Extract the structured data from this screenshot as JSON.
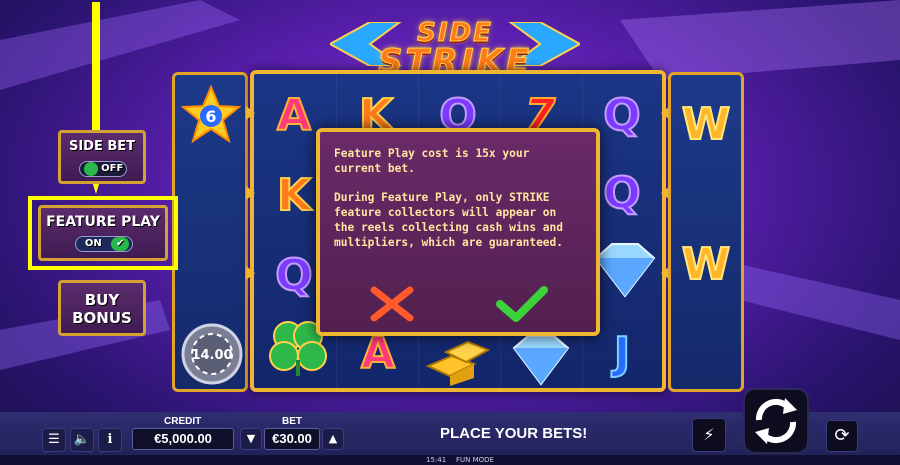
{
  "logo": {
    "line1": "SIDE",
    "line2": "STRIKE"
  },
  "side_reel_left": {
    "star_value": "6",
    "chip_value": "14.00"
  },
  "main_reels": {
    "visible_symbols": [
      "A",
      "K",
      "Q",
      "7",
      "Q",
      "K",
      "Q",
      "Q",
      "A",
      "J"
    ]
  },
  "side_reel_right": {
    "symbols": [
      "W",
      "W"
    ]
  },
  "popup": {
    "paragraph1": "Feature Play cost is 15x your current bet.",
    "paragraph2": "During Feature Play, only STRIKE feature collectors will appear on the reels collecting cash wins and multipliers, which are guaranteed.",
    "cancel_icon": "x-icon",
    "confirm_icon": "check-icon"
  },
  "left_panel": {
    "side_bet": {
      "label": "SIDE BET",
      "toggle_label": "OFF"
    },
    "feature_play": {
      "label": "FEATURE PLAY",
      "toggle_label": "ON"
    },
    "buy_bonus": {
      "line1": "BUY",
      "line2": "BONUS"
    }
  },
  "bottom_bar": {
    "credit_label": "CREDIT",
    "credit_value": "€5,000.00",
    "bet_label": "BET",
    "bet_value": "€30.00",
    "message": "PLACE YOUR BETS!"
  },
  "footer": {
    "time": "15:41",
    "mode": "FUN MODE"
  },
  "colors": {
    "accent_gold": "#f0b632",
    "highlight_yellow": "#ffff00",
    "popup_bg": "#6a2a68"
  }
}
